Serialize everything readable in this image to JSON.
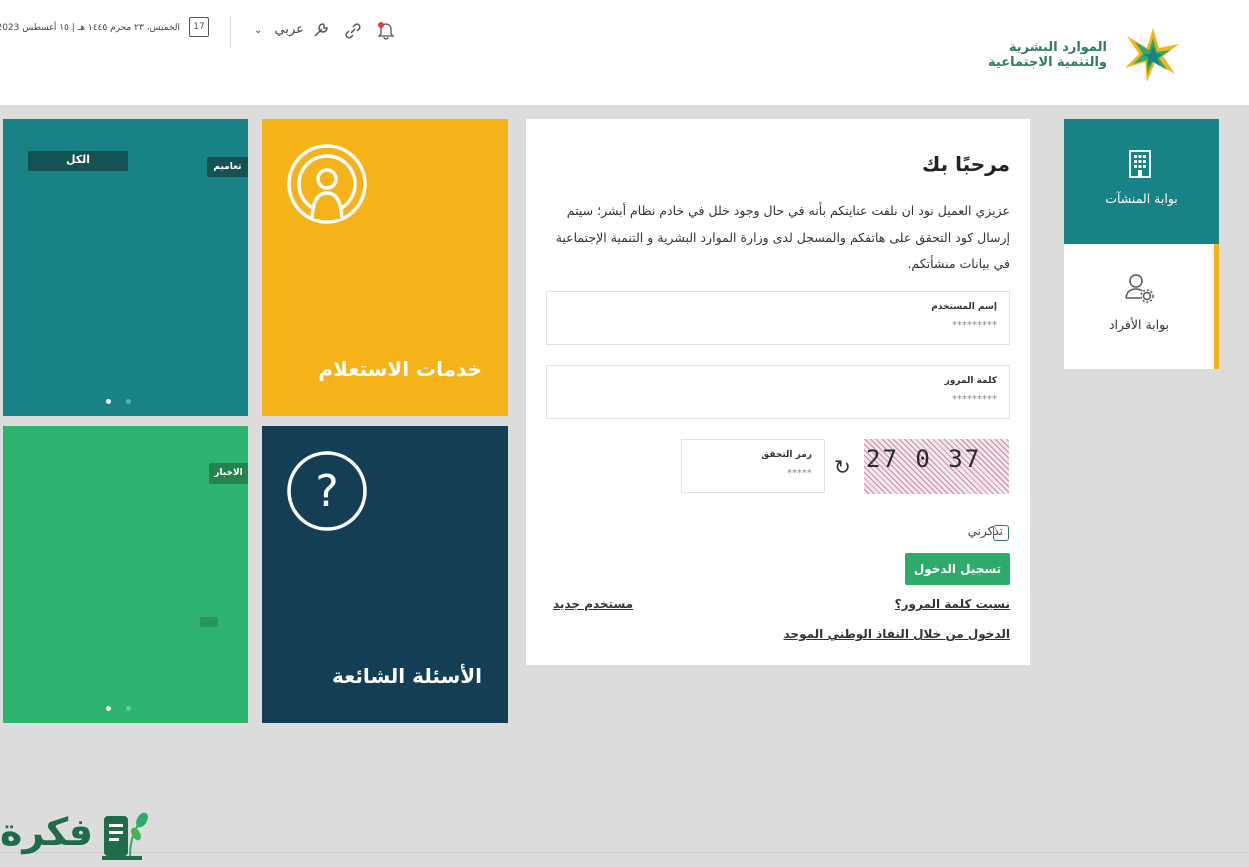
{
  "header": {
    "logo_line1": "الموارد البشرية",
    "logo_line2": "والتنمية الاجتماعية",
    "date": "الخميس، ٢٣ محرم ١٤٤٥ هـ | ١٥ أغسطس 2023",
    "calendar_day": "17",
    "language": "عربي",
    "colors": {
      "brand_green": "#2e7d5b"
    }
  },
  "tiles": {
    "teal": {
      "tab_all": "الكل",
      "tab_circulars": "تعاميم",
      "color": "#188287"
    },
    "green": {
      "tab_news": "الاخبار",
      "color": "#2eb46f"
    },
    "inquiry": {
      "title": "خدمات الاستعلام",
      "color": "#f6b319"
    },
    "faq": {
      "title": "الأسئلة الشائعة",
      "color": "#143d56"
    }
  },
  "login": {
    "welcome": "مرحبًا بك",
    "intro": "عزيزي العميل نود ان نلفت عنايتكم بأنه في حال وجود خلل في خادم نظام أبشر؛ سيتم إرسال كود التحقق على هاتفكم والمسجل لدى وزارة الموارد البشرية و التنمية الإجتماعية في بيانات منشأتكم.",
    "username_label": "إسم المستخدم",
    "username_value": "*********",
    "password_label": "كلمة المرور",
    "password_value": "*********",
    "captcha_label": "رمز التحقق",
    "captcha_value": "*****",
    "captcha_text": "27 0 37",
    "remember_label": "تذكرني",
    "login_button": "تسجيل الدخول",
    "forgot_password": "نسيت كلمة المرور؟",
    "new_user": "مستخدم جديد",
    "nafath_login": "الدخول من خلال النفاذ الوطني الموحد",
    "button_color": "#2eab6a"
  },
  "sidebar": {
    "items": [
      {
        "label": "بوابة المنشآت",
        "icon": "building-icon",
        "active": true
      },
      {
        "label": "بوابة الأفراد",
        "icon": "user-gear-icon",
        "active": false
      }
    ]
  },
  "watermark": {
    "text": "فكرة"
  }
}
